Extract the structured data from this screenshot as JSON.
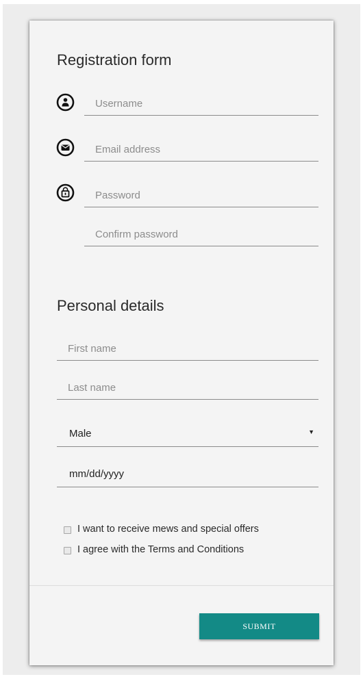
{
  "registration": {
    "title": "Registration form",
    "username_placeholder": "Username",
    "email_placeholder": "Email address",
    "password_placeholder": "Password",
    "confirm_password_placeholder": "Confirm password",
    "icons": [
      "user-circle-icon",
      "envelope-circle-icon",
      "lock-circle-icon"
    ]
  },
  "personal": {
    "title": "Personal details",
    "first_name_placeholder": "First name",
    "last_name_placeholder": "Last name",
    "gender_value": "Male",
    "birthdate_value": "mm/dd/yyyy"
  },
  "checkboxes": {
    "newsletter_label": "I want to receive mews and special offers",
    "terms_label": "I agree with the Terms and Conditions"
  },
  "actions": {
    "submit_label": "SUBMIT"
  },
  "colors": {
    "accent": "#138a86"
  }
}
